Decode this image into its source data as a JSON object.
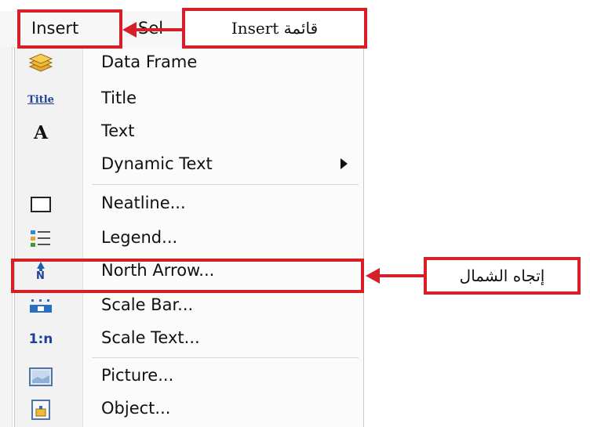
{
  "menubar": {
    "insert_label": "Insert",
    "next_label_partial": "Sel"
  },
  "callouts": {
    "insert_callout": "قائمة Insert",
    "north_arrow_callout": "إتجاه الشمال"
  },
  "menu": {
    "items": [
      {
        "label": "Data Frame",
        "icon": "data-frame-icon"
      },
      {
        "label": "Title",
        "icon": "title-icon",
        "icon_text": "Title"
      },
      {
        "label": "Text",
        "icon": "text-icon",
        "icon_text": "A"
      },
      {
        "label": "Dynamic Text",
        "icon": "none",
        "has_submenu": true
      },
      {
        "label": "Neatline...",
        "icon": "neatline-icon"
      },
      {
        "label": "Legend...",
        "icon": "legend-icon"
      },
      {
        "label": "North Arrow...",
        "icon": "north-arrow-icon",
        "icon_text": "N",
        "highlighted": true
      },
      {
        "label": "Scale Bar...",
        "icon": "scale-bar-icon"
      },
      {
        "label": "Scale Text...",
        "icon": "scale-text-icon",
        "icon_text": "1:n"
      },
      {
        "label": "Picture...",
        "icon": "picture-icon"
      },
      {
        "label": "Object...",
        "icon": "object-icon"
      }
    ]
  },
  "colors": {
    "highlight_red": "#d61f26",
    "menu_background": "#fbfbfb"
  }
}
